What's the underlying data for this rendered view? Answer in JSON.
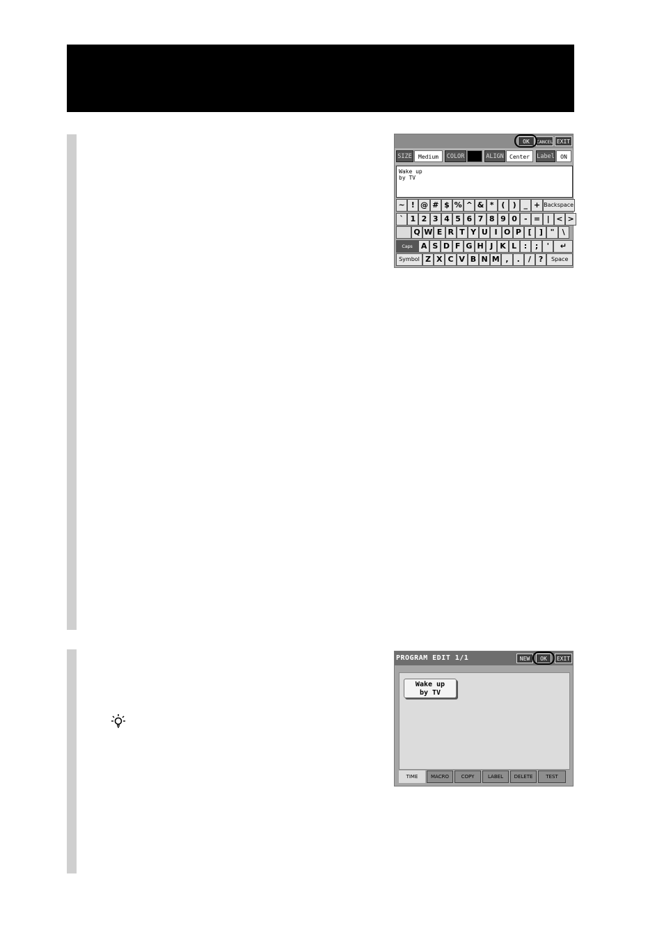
{
  "keyboard_screen": {
    "top_buttons": {
      "ok": "OK",
      "cancel": "CANCEL",
      "exit": "EXIT"
    },
    "settings": {
      "size_label": "SIZE",
      "size_value": "Medium",
      "color_label": "COLOR",
      "color_value": "#000000",
      "align_label": "ALIGN",
      "align_value": "Center",
      "label_label": "Label",
      "label_value": "ON"
    },
    "text_lines": [
      "Wake up",
      "by TV"
    ],
    "rows": [
      [
        "~",
        "!",
        "@",
        "#",
        "$",
        "%",
        "^",
        "&",
        "*",
        "(",
        ")",
        "_",
        "+",
        "Backspace"
      ],
      [
        "`",
        "1",
        "2",
        "3",
        "4",
        "5",
        "6",
        "7",
        "8",
        "9",
        "0",
        "-",
        "=",
        "|",
        "<",
        ">"
      ],
      [
        "",
        "Q",
        "W",
        "E",
        "R",
        "T",
        "Y",
        "U",
        "I",
        "O",
        "P",
        "[",
        "]",
        "\"",
        "\\"
      ],
      [
        "Caps Lock",
        "A",
        "S",
        "D",
        "F",
        "G",
        "H",
        "J",
        "K",
        "L",
        ":",
        ";",
        "'",
        "↵"
      ],
      [
        "Symbol",
        "Z",
        "X",
        "C",
        "V",
        "B",
        "N",
        "M",
        ",",
        ".",
        "/",
        "?",
        "Space"
      ]
    ]
  },
  "program_edit_screen": {
    "title": "PROGRAM EDIT 1/1",
    "top_buttons": {
      "new": "NEW",
      "ok": "OK",
      "exit": "EXIT"
    },
    "program_lines": [
      "Wake up",
      "by TV"
    ],
    "tabs": [
      "TIME",
      "MACRO",
      "COPY",
      "LABEL",
      "DELETE",
      "TEST"
    ]
  },
  "icons": {
    "tip": "lightbulb-tip-icon"
  }
}
